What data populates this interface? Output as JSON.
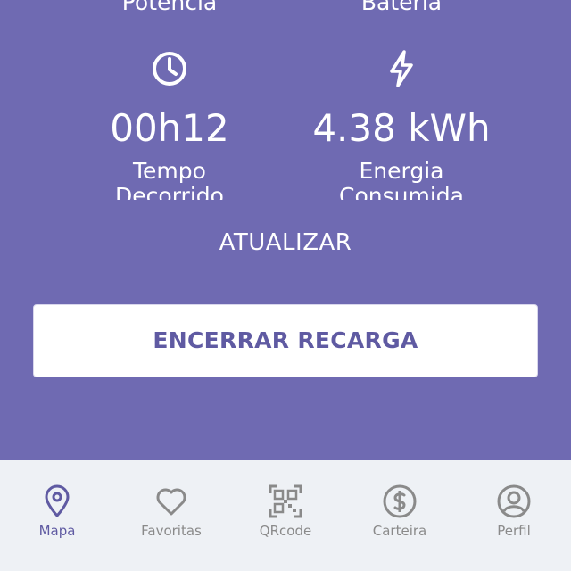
{
  "panel": {
    "top_left_label": "Potência",
    "top_right_label": "Bateria",
    "metrics": [
      {
        "icon": "clock-icon",
        "value": "00h12",
        "label": "Tempo Decorrido"
      },
      {
        "icon": "lightning-icon",
        "value": "4.38 kWh",
        "label": "Energia Consumida"
      }
    ],
    "refresh_label": "ATUALIZAR",
    "end_button_label": "ENCERRAR RECARGA"
  },
  "tabs": [
    {
      "icon": "map-pin-icon",
      "label": "Mapa",
      "active": true
    },
    {
      "icon": "heart-icon",
      "label": "Favoritas",
      "active": false
    },
    {
      "icon": "qrcode-icon",
      "label": "QRcode",
      "active": false
    },
    {
      "icon": "dollar-icon",
      "label": "Carteira",
      "active": false
    },
    {
      "icon": "user-icon",
      "label": "Perfil",
      "active": false
    }
  ],
  "colors": {
    "panel_bg": "#6f6ab2",
    "accent": "#5f5aa2",
    "tabbar_bg": "#eef1f5",
    "inactive_tab": "#8a8a8a"
  }
}
